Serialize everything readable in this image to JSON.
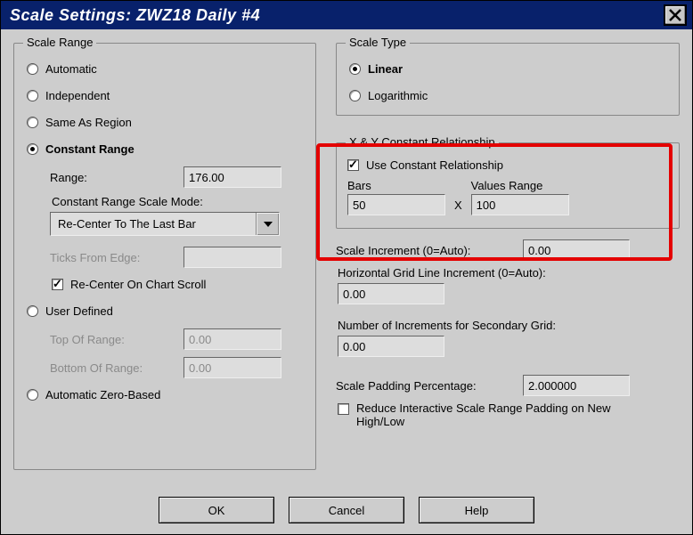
{
  "title": "Scale Settings: ZWZ18  Daily  #4",
  "scaleRange": {
    "groupTitle": "Scale Range",
    "options": {
      "automatic": "Automatic",
      "independent": "Independent",
      "sameAsRegion": "Same As Region",
      "constantRange": "Constant Range",
      "userDefined": "User Defined",
      "autoZero": "Automatic Zero-Based"
    },
    "rangeLabel": "Range:",
    "rangeValue": "176.00",
    "modeLabel": "Constant Range Scale Mode:",
    "modeValue": "Re-Center To The Last Bar",
    "ticksLabel": "Ticks From Edge:",
    "ticksValue": "",
    "recenterScroll": "Re-Center On Chart Scroll",
    "topLabel": "Top Of Range:",
    "topValue": "0.00",
    "bottomLabel": "Bottom Of Range:",
    "bottomValue": "0.00"
  },
  "scaleType": {
    "groupTitle": "Scale Type",
    "linear": "Linear",
    "log": "Logarithmic"
  },
  "xy": {
    "groupTitle": "X & Y Constant Relationship",
    "useConst": "Use Constant Relationship",
    "barsLabel": "Bars",
    "barsValue": "50",
    "xSym": "X",
    "valsLabel": "Values Range",
    "valsValue": "100"
  },
  "scaleIncrLabel": "Scale Increment (0=Auto):",
  "scaleIncrValue": "0.00",
  "hgridLabel": "Horizontal Grid Line Increment (0=Auto):",
  "hgridValue": "0.00",
  "nsecLabel": "Number of Increments for Secondary Grid:",
  "nsecValue": "0.00",
  "padLabel": "Scale Padding Percentage:",
  "padValue": "2.000000",
  "reduceLabel": "Reduce Interactive Scale Range Padding on New High/Low",
  "buttons": {
    "ok": "OK",
    "cancel": "Cancel",
    "help": "Help"
  }
}
